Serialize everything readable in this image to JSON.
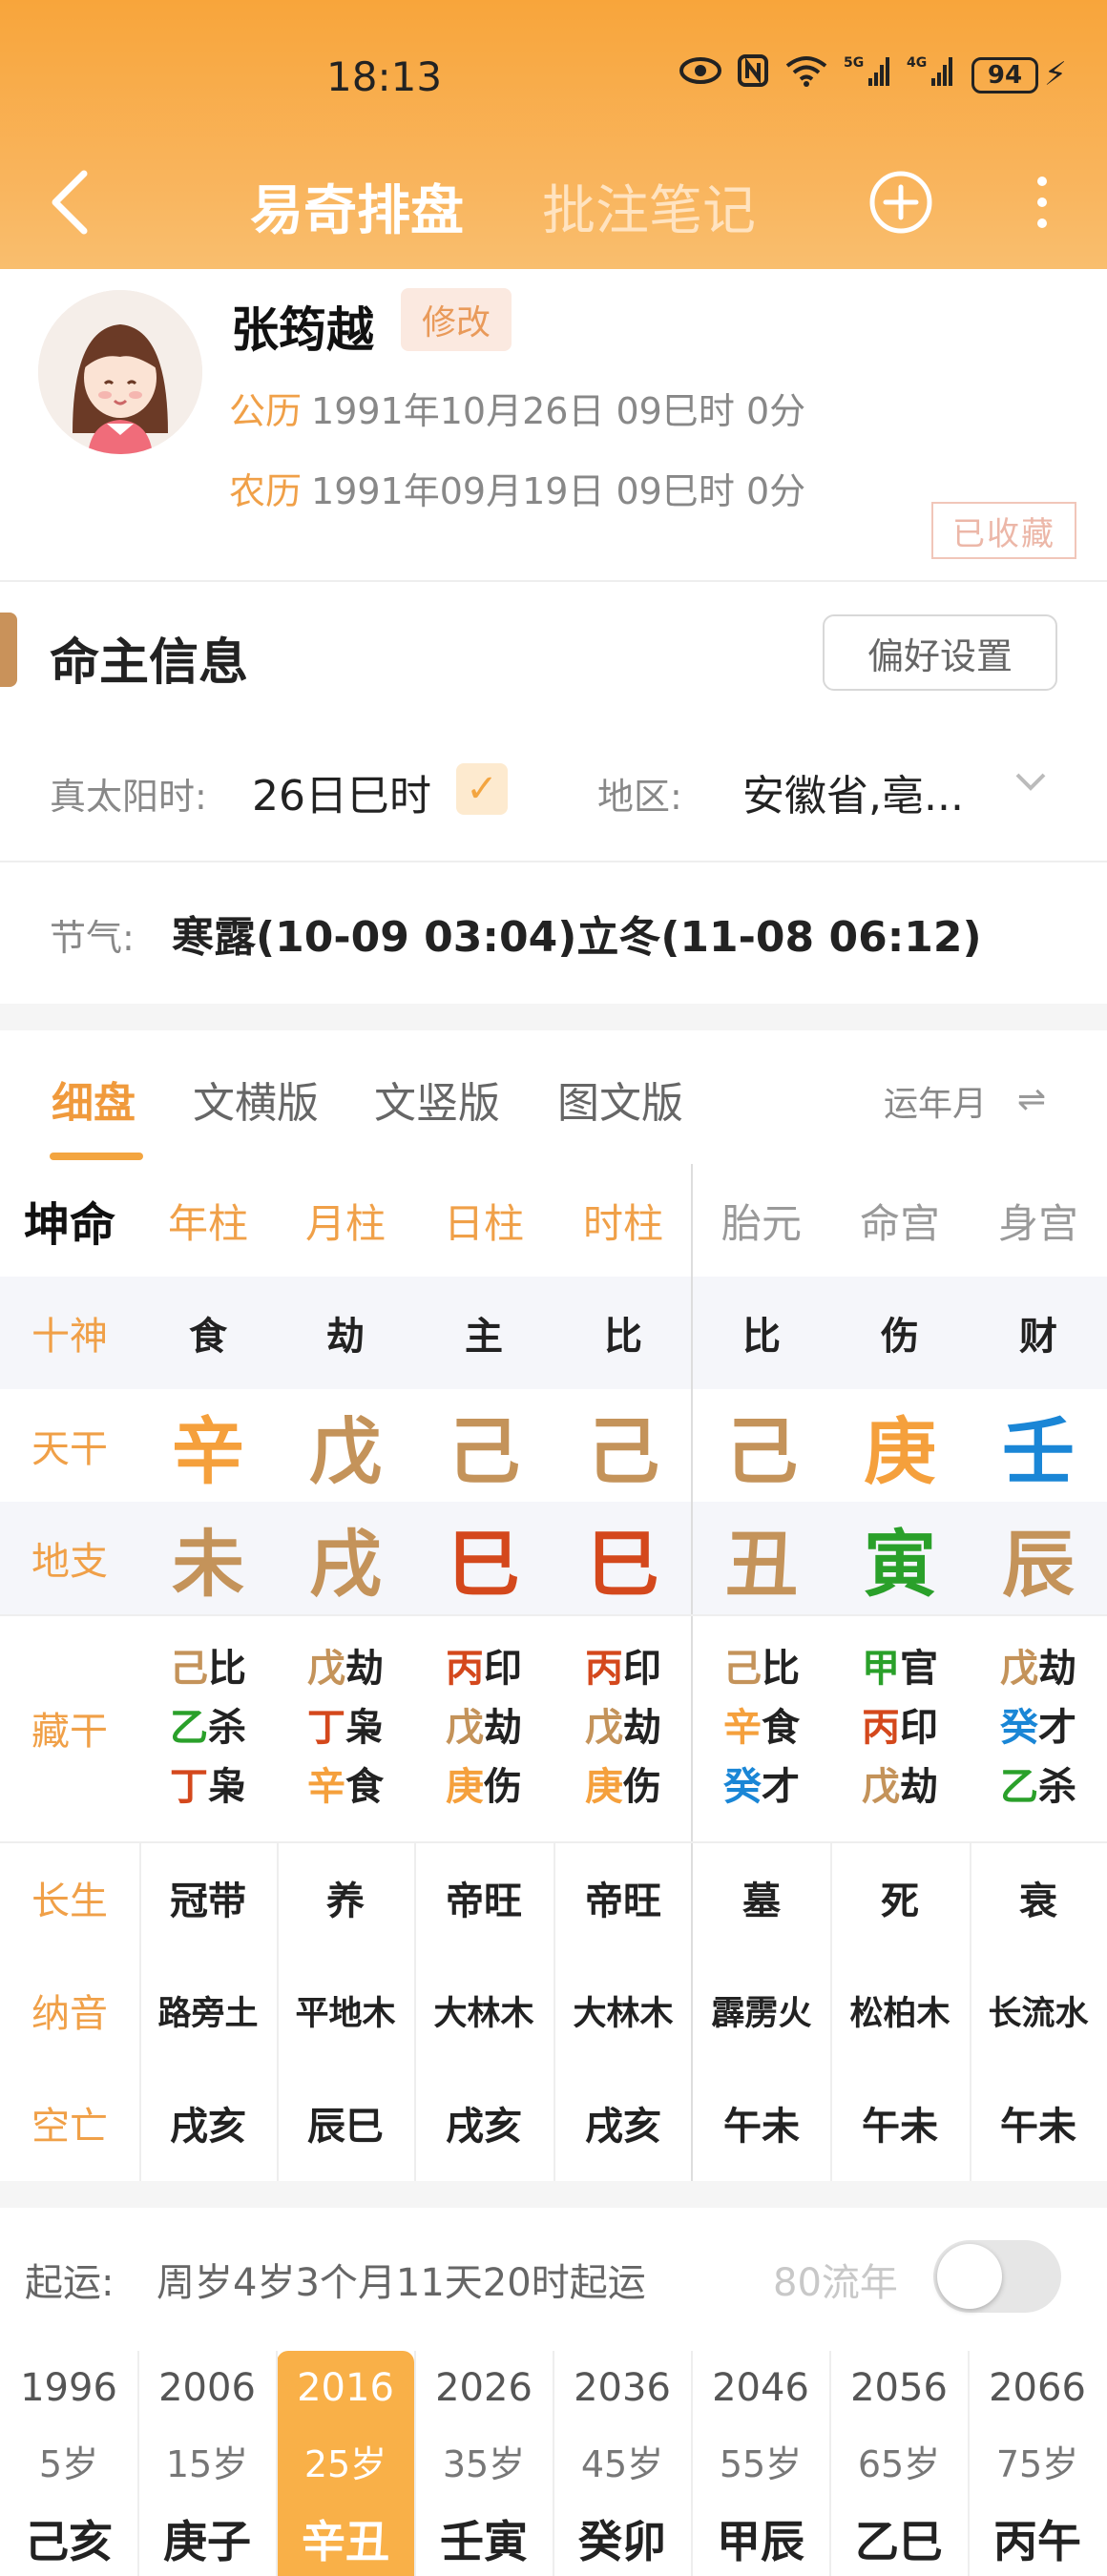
{
  "status": {
    "time": "18:13",
    "battery": "94"
  },
  "nav": {
    "tab_active": "易奇排盘",
    "tab_inactive": "批注笔记"
  },
  "profile": {
    "name": "张筠越",
    "edit_label": "修改",
    "solar_label": "公历",
    "solar_value": "1991年10月26日 09巳时 0分",
    "lunar_label": "农历",
    "lunar_value": "1991年09月19日 09巳时 0分",
    "collected_label": "已收藏"
  },
  "info": {
    "section_title": "命主信息",
    "pref_button": "偏好设置",
    "true_solar_label": "真太阳时:",
    "true_solar_value": "26日巳时",
    "region_label": "地区:",
    "region_value": "安徽省,亳...",
    "jieqi_label": "节气:",
    "jieqi_value": "寒露(10-09 03:04)立冬(11-08 06:12)"
  },
  "tabs": {
    "items": [
      "细盘",
      "文横版",
      "文竖版",
      "图文版"
    ],
    "mode": "运年月"
  },
  "chart": {
    "corner": "坤命",
    "columns": [
      "年柱",
      "月柱",
      "日柱",
      "时柱",
      "胎元",
      "命宫",
      "身宫"
    ],
    "row_labels": {
      "shishen": "十神",
      "tiangan": "天干",
      "dizhi": "地支",
      "canggan": "藏干",
      "changsheng": "长生",
      "nayin": "纳音",
      "kongwang": "空亡"
    },
    "shishen": [
      "食",
      "劫",
      "主",
      "比",
      "比",
      "伤",
      "财"
    ],
    "tiangan": [
      {
        "char": "辛",
        "color": "#f5a03c"
      },
      {
        "char": "戊",
        "color": "#c4935a"
      },
      {
        "char": "己",
        "color": "#c4935a"
      },
      {
        "char": "己",
        "color": "#c4935a"
      },
      {
        "char": "己",
        "color": "#c4935a"
      },
      {
        "char": "庚",
        "color": "#f5a03c"
      },
      {
        "char": "壬",
        "color": "#1a86d6"
      }
    ],
    "dizhi": [
      {
        "char": "未",
        "color": "#c4935a"
      },
      {
        "char": "戌",
        "color": "#c4935a"
      },
      {
        "char": "巳",
        "color": "#d4481c"
      },
      {
        "char": "巳",
        "color": "#d4481c"
      },
      {
        "char": "丑",
        "color": "#c4935a"
      },
      {
        "char": "寅",
        "color": "#2aa02a"
      },
      {
        "char": "辰",
        "color": "#c4935a"
      }
    ],
    "canggan": [
      [
        {
          "stem": "己",
          "god": "比",
          "color": "#c4935a"
        },
        {
          "stem": "乙",
          "god": "杀",
          "color": "#2aa02a"
        },
        {
          "stem": "丁",
          "god": "枭",
          "color": "#d4481c"
        }
      ],
      [
        {
          "stem": "戊",
          "god": "劫",
          "color": "#c4935a"
        },
        {
          "stem": "丁",
          "god": "枭",
          "color": "#d4481c"
        },
        {
          "stem": "辛",
          "god": "食",
          "color": "#f5a03c"
        }
      ],
      [
        {
          "stem": "丙",
          "god": "印",
          "color": "#d4481c"
        },
        {
          "stem": "戊",
          "god": "劫",
          "color": "#c4935a"
        },
        {
          "stem": "庚",
          "god": "伤",
          "color": "#f5a03c"
        }
      ],
      [
        {
          "stem": "丙",
          "god": "印",
          "color": "#d4481c"
        },
        {
          "stem": "戊",
          "god": "劫",
          "color": "#c4935a"
        },
        {
          "stem": "庚",
          "god": "伤",
          "color": "#f5a03c"
        }
      ],
      [
        {
          "stem": "己",
          "god": "比",
          "color": "#c4935a"
        },
        {
          "stem": "辛",
          "god": "食",
          "color": "#f5a03c"
        },
        {
          "stem": "癸",
          "god": "才",
          "color": "#1a86d6"
        }
      ],
      [
        {
          "stem": "甲",
          "god": "官",
          "color": "#2aa02a"
        },
        {
          "stem": "丙",
          "god": "印",
          "color": "#d4481c"
        },
        {
          "stem": "戊",
          "god": "劫",
          "color": "#c4935a"
        }
      ],
      [
        {
          "stem": "戊",
          "god": "劫",
          "color": "#c4935a"
        },
        {
          "stem": "癸",
          "god": "才",
          "color": "#1a86d6"
        },
        {
          "stem": "乙",
          "god": "杀",
          "color": "#2aa02a"
        }
      ]
    ],
    "changsheng": [
      "冠带",
      "养",
      "帝旺",
      "帝旺",
      "墓",
      "死",
      "衰"
    ],
    "nayin": [
      "路旁土",
      "平地木",
      "大林木",
      "大林木",
      "霹雳火",
      "松柏木",
      "长流水"
    ],
    "kongwang": [
      "戌亥",
      "辰巳",
      "戌亥",
      "戌亥",
      "午未",
      "午未",
      "午未"
    ]
  },
  "qiyun": {
    "label": "起运:",
    "text": "周岁4岁3个月11天20时起运",
    "liunian_label": "80流年"
  },
  "dayun": [
    {
      "year": "1996",
      "age": "5岁",
      "gz": "己亥"
    },
    {
      "year": "2006",
      "age": "15岁",
      "gz": "庚子"
    },
    {
      "year": "2016",
      "age": "25岁",
      "gz": "辛丑",
      "active": true
    },
    {
      "year": "2026",
      "age": "35岁",
      "gz": "壬寅"
    },
    {
      "year": "2036",
      "age": "45岁",
      "gz": "癸卯"
    },
    {
      "year": "2046",
      "age": "55岁",
      "gz": "甲辰"
    },
    {
      "year": "2056",
      "age": "65岁",
      "gz": "乙巳"
    },
    {
      "year": "2066",
      "age": "75岁",
      "gz": "丙午"
    }
  ],
  "colors": {
    "accent": "#f3a540",
    "header": "#f8a53b"
  }
}
